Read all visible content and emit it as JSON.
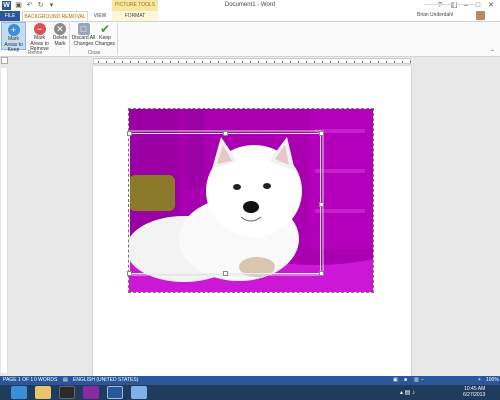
{
  "titlebar": {
    "document_title": "Document1 - Word",
    "contextual_group": "PICTURE TOOLS",
    "user_name": "Brian Underdahl",
    "qat": [
      "save-icon",
      "undo-icon",
      "redo-icon",
      "customize-icon"
    ]
  },
  "tabs": {
    "file": "FILE",
    "background_removal": "BACKGROUND REMOVAL",
    "view": "VIEW",
    "format": "FORMAT"
  },
  "ribbon": {
    "refine": {
      "group_label": "Refine",
      "mark_keep": "Mark Areas to Keep",
      "mark_remove": "Mark Areas to Remove",
      "delete_mark": "Delete Mark"
    },
    "close": {
      "group_label": "Close",
      "discard": "Discard All Changes",
      "keep": "Keep Changes"
    }
  },
  "statusbar": {
    "page": "PAGE 1 OF 1",
    "words": "0 WORDS",
    "language": "ENGLISH (UNITED STATES)",
    "zoom": "100%"
  },
  "taskbar": {
    "time": "10:45 AM",
    "date": "6/27/2013"
  },
  "colors": {
    "brand": "#2b579a",
    "removal_overlay": "#b000b8",
    "contextual": "#f6e7a5"
  }
}
